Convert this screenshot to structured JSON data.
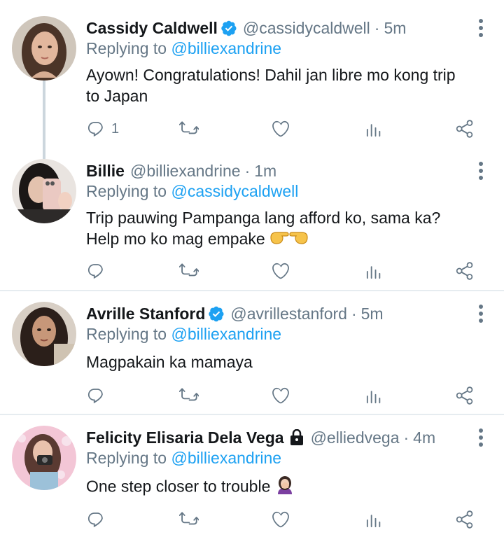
{
  "replying_to_label": "Replying to",
  "tweets": [
    {
      "name": "Cassidy Caldwell",
      "verified": true,
      "handle": "@cassidycaldwell",
      "separator": "·",
      "time": "5m",
      "reply_to": "@billiexandrine",
      "text_lines": [
        "Ayown! Congratulations! Dahil jan libre mo kong trip",
        "to Japan"
      ],
      "reply_count": "1"
    },
    {
      "name": "Billie",
      "verified": false,
      "handle": "@billiexandrine",
      "separator": "·",
      "time": "1m",
      "reply_to": "@cassidycaldwell",
      "text_lines": [
        "Trip pauwing Pampanga lang afford ko, sama ka?",
        "Help mo ko mag empake"
      ],
      "emoji_name": "pointing-hands-emoji",
      "reply_count": ""
    },
    {
      "name": "Avrille Stanford",
      "verified": true,
      "handle": "@avrillestanford",
      "separator": "·",
      "time": "5m",
      "reply_to": "@billiexandrine",
      "text_lines": [
        "Magpakain ka mamaya"
      ],
      "reply_count": ""
    },
    {
      "name": "Felicity Elisaria Dela Vega",
      "verified": false,
      "protected": true,
      "handle": "@elliedvega",
      "separator": "·",
      "time": "4m",
      "reply_to": "@billiexandrine",
      "text_lines": [
        "One step closer to trouble"
      ],
      "emoji_name": "woman-facepalm-emoji",
      "reply_count": ""
    }
  ],
  "icons": {
    "reply": "reply-icon",
    "retweet": "retweet-icon",
    "like": "heart-icon",
    "analytics": "analytics-icon",
    "share": "share-icon",
    "more": "more-vertical-icon"
  },
  "colors": {
    "text": "#14171a",
    "secondary": "#657786",
    "accent": "#1da1f2",
    "verified": "#1da1f2",
    "divider": "#e6ecf0",
    "thread_line": "#ccd6dd"
  }
}
